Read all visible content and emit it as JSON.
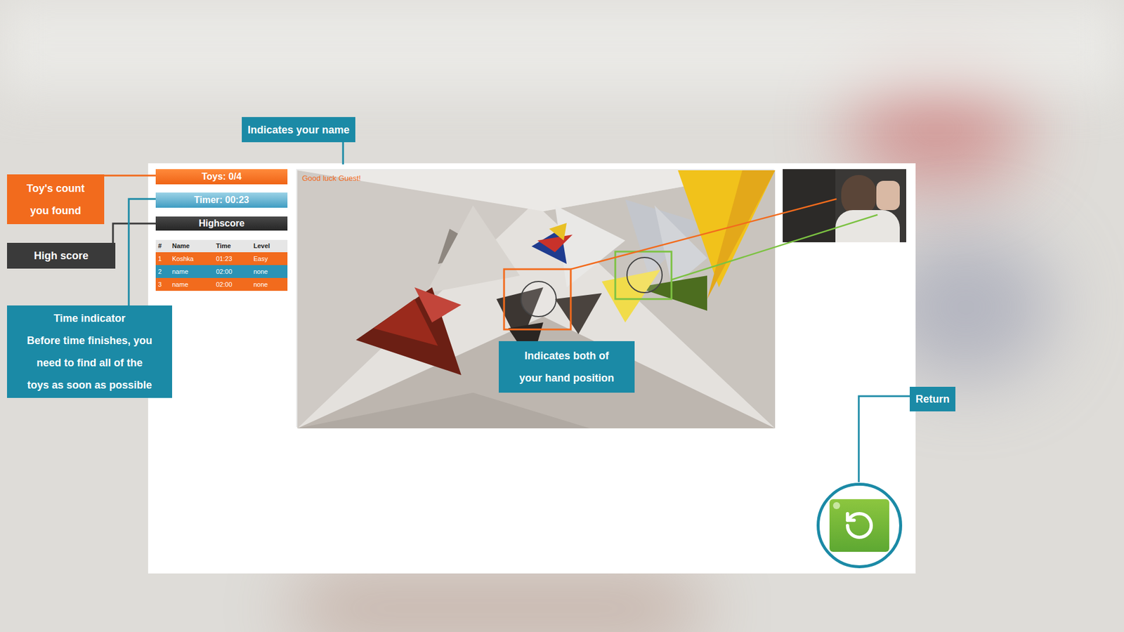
{
  "game": {
    "toys": "Toys: 0/4",
    "timer": "Timer: 00:23",
    "highscore_title": "Highscore",
    "greeting": "Good luck Guest!"
  },
  "highscore": {
    "columns": [
      "#",
      "Name",
      "Time",
      "Level"
    ],
    "rows": [
      {
        "cells": [
          "1",
          "Koshka",
          "01:23",
          "Easy"
        ],
        "color": "#f26b1d"
      },
      {
        "cells": [
          "2",
          "name",
          "02:00",
          "none"
        ],
        "color": "#2b93b5"
      },
      {
        "cells": [
          "3",
          "name",
          "02:00",
          "none"
        ],
        "color": "#f26b1d"
      }
    ]
  },
  "hand_markers": [
    {
      "hand": "left",
      "color": "#f26b1d"
    },
    {
      "hand": "right",
      "color": "#7cc242"
    }
  ],
  "annotations": [
    {
      "lines": [
        "Indicates your name"
      ],
      "color": "#1b8aa6"
    },
    {
      "lines": [
        "Toy's count",
        "you found"
      ],
      "color": "#f26b1d"
    },
    {
      "lines": [
        "High score"
      ],
      "color": "#3a3a3a"
    },
    {
      "lines": [
        "Time indicator",
        "Before time finishes, you",
        "need to find all of the",
        "toys as soon as possible"
      ],
      "color": "#1b8aa6"
    },
    {
      "lines": [
        "Indicates both of",
        "your hand position"
      ],
      "color": "#1b8aa6"
    },
    {
      "lines": [
        "Return"
      ],
      "color": "#1b8aa6"
    }
  ]
}
